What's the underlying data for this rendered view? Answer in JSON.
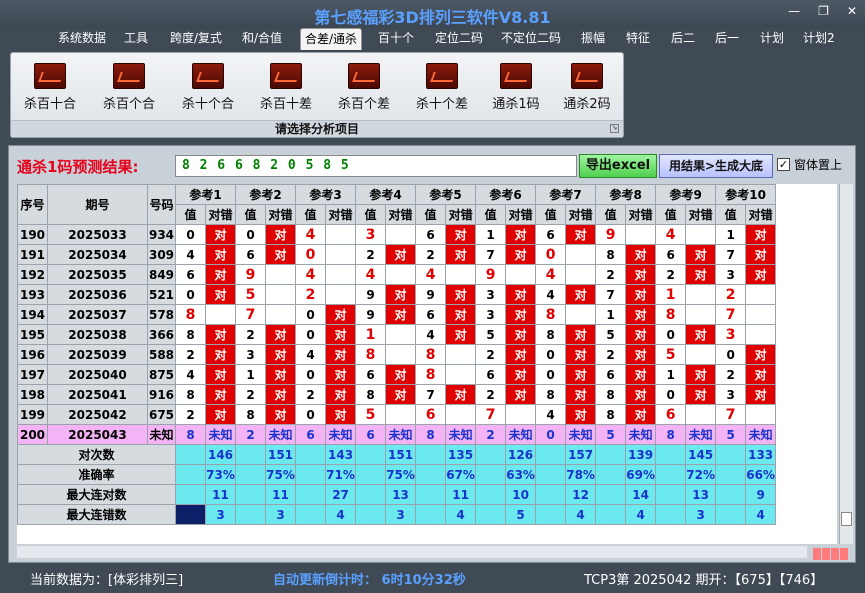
{
  "window": {
    "title": "第七感福彩3D排列三软件V8.81",
    "controls": [
      "—",
      "❐",
      "✕"
    ]
  },
  "menu": {
    "items": [
      "系统数据",
      "工具",
      "跨度/复式",
      "和/合值",
      "合差/通杀",
      "百十个",
      "定位二码",
      "不定位二码",
      "振幅",
      "特征",
      "后二",
      "后一",
      "计划",
      "计划2"
    ],
    "active": "合差/通杀"
  },
  "ribbon": {
    "buttons": [
      "杀百十合",
      "杀百个合",
      "杀十个合",
      "杀百十差",
      "杀百个差",
      "杀十个差",
      "通杀1码",
      "通杀2码"
    ],
    "group_label": "请选择分析项目"
  },
  "predict": {
    "label": "通杀1码预测结果:",
    "value": "8 2 6 6 8 2 0 5 8 5",
    "excel_button": "导出excel",
    "gen_button": "用结果>生成大底",
    "topmost_label": "窗体置上",
    "topmost_checked": true
  },
  "table": {
    "headers": {
      "idx": "序号",
      "date": "期号",
      "num": "号码",
      "groups": [
        "参考1",
        "参考2",
        "参考3",
        "参考4",
        "参考5",
        "参考6",
        "参考7",
        "参考8",
        "参考9",
        "参考10"
      ],
      "val": "值",
      "res": "对错"
    },
    "hit_text": "对",
    "rows": [
      {
        "idx": "190",
        "date": "2025033",
        "num": "934",
        "cells": [
          [
            "0",
            true
          ],
          [
            "0",
            true
          ],
          [
            "4",
            false
          ],
          [
            "3",
            false
          ],
          [
            "6",
            true
          ],
          [
            "1",
            true
          ],
          [
            "6",
            true
          ],
          [
            "9",
            false
          ],
          [
            "4",
            false
          ],
          [
            "1",
            true
          ]
        ]
      },
      {
        "idx": "191",
        "date": "2025034",
        "num": "309",
        "cells": [
          [
            "4",
            true
          ],
          [
            "6",
            true
          ],
          [
            "0",
            false
          ],
          [
            "2",
            true
          ],
          [
            "2",
            true
          ],
          [
            "7",
            true
          ],
          [
            "0",
            false
          ],
          [
            "8",
            true
          ],
          [
            "6",
            true
          ],
          [
            "7",
            true
          ]
        ]
      },
      {
        "idx": "192",
        "date": "2025035",
        "num": "849",
        "cells": [
          [
            "6",
            true
          ],
          [
            "9",
            false
          ],
          [
            "4",
            false
          ],
          [
            "4",
            false
          ],
          [
            "4",
            false
          ],
          [
            "9",
            false
          ],
          [
            "4",
            false
          ],
          [
            "2",
            true
          ],
          [
            "2",
            true
          ],
          [
            "3",
            true
          ]
        ]
      },
      {
        "idx": "193",
        "date": "2025036",
        "num": "521",
        "cells": [
          [
            "0",
            true
          ],
          [
            "5",
            false
          ],
          [
            "2",
            false
          ],
          [
            "9",
            true
          ],
          [
            "9",
            true
          ],
          [
            "3",
            true
          ],
          [
            "4",
            true
          ],
          [
            "7",
            true
          ],
          [
            "1",
            false
          ],
          [
            "2",
            false
          ]
        ]
      },
      {
        "idx": "194",
        "date": "2025037",
        "num": "578",
        "cells": [
          [
            "8",
            false
          ],
          [
            "7",
            false
          ],
          [
            "0",
            true
          ],
          [
            "9",
            true
          ],
          [
            "6",
            true
          ],
          [
            "3",
            true
          ],
          [
            "8",
            false
          ],
          [
            "1",
            true
          ],
          [
            "8",
            false
          ],
          [
            "7",
            false
          ]
        ]
      },
      {
        "idx": "195",
        "date": "2025038",
        "num": "366",
        "cells": [
          [
            "8",
            true
          ],
          [
            "2",
            true
          ],
          [
            "0",
            true
          ],
          [
            "1",
            false
          ],
          [
            "4",
            true
          ],
          [
            "5",
            true
          ],
          [
            "8",
            true
          ],
          [
            "5",
            true
          ],
          [
            "0",
            true
          ],
          [
            "3",
            false
          ]
        ]
      },
      {
        "idx": "196",
        "date": "2025039",
        "num": "588",
        "cells": [
          [
            "2",
            true
          ],
          [
            "3",
            true
          ],
          [
            "4",
            true
          ],
          [
            "8",
            false
          ],
          [
            "8",
            false
          ],
          [
            "2",
            true
          ],
          [
            "0",
            true
          ],
          [
            "2",
            true
          ],
          [
            "5",
            false
          ],
          [
            "0",
            true
          ]
        ]
      },
      {
        "idx": "197",
        "date": "2025040",
        "num": "875",
        "cells": [
          [
            "4",
            true
          ],
          [
            "1",
            true
          ],
          [
            "0",
            true
          ],
          [
            "6",
            true
          ],
          [
            "8",
            false
          ],
          [
            "6",
            true
          ],
          [
            "0",
            true
          ],
          [
            "6",
            true
          ],
          [
            "1",
            true
          ],
          [
            "2",
            true
          ]
        ]
      },
      {
        "idx": "198",
        "date": "2025041",
        "num": "916",
        "cells": [
          [
            "8",
            true
          ],
          [
            "2",
            true
          ],
          [
            "2",
            true
          ],
          [
            "8",
            true
          ],
          [
            "7",
            true
          ],
          [
            "2",
            true
          ],
          [
            "8",
            true
          ],
          [
            "8",
            true
          ],
          [
            "0",
            true
          ],
          [
            "3",
            true
          ]
        ]
      },
      {
        "idx": "199",
        "date": "2025042",
        "num": "675",
        "cells": [
          [
            "2",
            true
          ],
          [
            "8",
            true
          ],
          [
            "0",
            true
          ],
          [
            "5",
            false
          ],
          [
            "6",
            false
          ],
          [
            "7",
            false
          ],
          [
            "4",
            true
          ],
          [
            "8",
            true
          ],
          [
            "6",
            false
          ],
          [
            "7",
            false
          ]
        ]
      }
    ],
    "current": {
      "idx": "200",
      "date": "2025043",
      "num": "未知",
      "unknown_text": "未知",
      "values": [
        "8",
        "2",
        "6",
        "6",
        "8",
        "2",
        "0",
        "5",
        "8",
        "5"
      ]
    },
    "stats": [
      {
        "label": "对次数",
        "values": [
          "146",
          "151",
          "143",
          "151",
          "135",
          "126",
          "157",
          "139",
          "145",
          "133"
        ]
      },
      {
        "label": "准确率",
        "values": [
          "73%",
          "75%",
          "71%",
          "75%",
          "67%",
          "63%",
          "78%",
          "69%",
          "72%",
          "66%"
        ]
      },
      {
        "label": "最大连对数",
        "values": [
          "11",
          "11",
          "27",
          "13",
          "11",
          "10",
          "12",
          "14",
          "13",
          "9"
        ]
      },
      {
        "label": "最大连错数",
        "values": [
          "3",
          "3",
          "4",
          "3",
          "4",
          "5",
          "4",
          "4",
          "3",
          "4"
        ]
      }
    ]
  },
  "status": {
    "source": "当前数据为：[体彩排列三]",
    "countdown": "自动更新倒计时：  6时10分32秒",
    "period": "TCP3第 2025042 期开：【675】【746】"
  }
}
